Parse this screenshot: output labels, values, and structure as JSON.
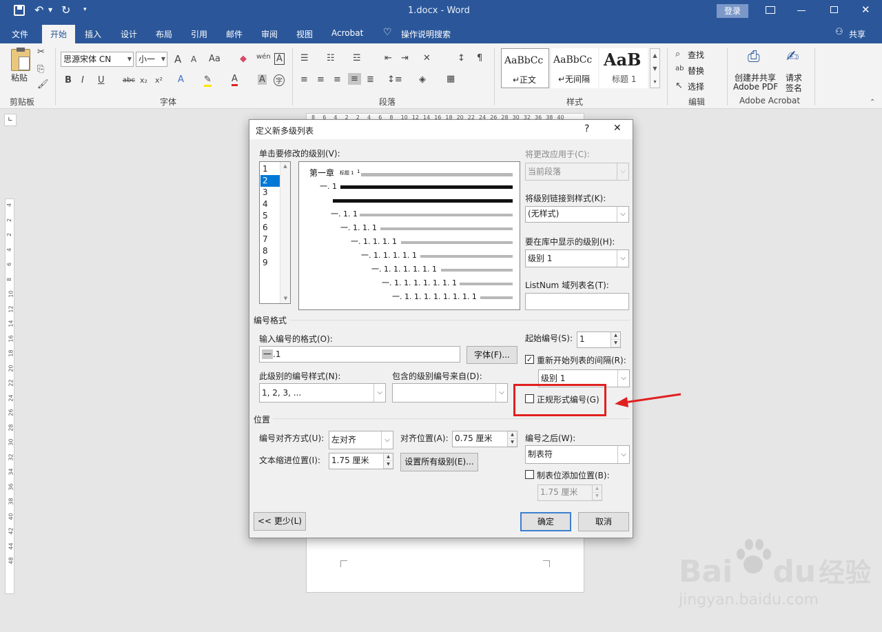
{
  "window": {
    "title": "1.docx - Word",
    "login": "登录"
  },
  "tabs": [
    "文件",
    "开始",
    "插入",
    "设计",
    "布局",
    "引用",
    "邮件",
    "审阅",
    "视图",
    "Acrobat",
    "操作说明搜索"
  ],
  "share": "共享",
  "ribbon": {
    "clipboard": {
      "label": "剪贴板",
      "paste": "粘贴"
    },
    "font": {
      "label": "字体",
      "name": "思源宋体 CN",
      "size": "小一",
      "tools": [
        "A",
        "A",
        "Aa",
        "wén",
        "A",
        "B",
        "I",
        "U",
        "abc",
        "x₂",
        "x²",
        "A",
        "A",
        "A",
        "A",
        "字"
      ]
    },
    "paragraph": {
      "label": "段落"
    },
    "styles": {
      "label": "样式",
      "items": [
        {
          "preview": "AaBbCc",
          "name": "↵正文"
        },
        {
          "preview": "AaBbCc",
          "name": "↵无间隔"
        },
        {
          "preview": "AaB",
          "name": "标题 1"
        }
      ]
    },
    "editing": {
      "label": "编辑",
      "find": "查找",
      "replace": "替换",
      "select": "选择"
    },
    "acrobat": {
      "label": "Adobe Acrobat",
      "create1": "创建并共享",
      "create2": "Adobe PDF",
      "sign1": "请求",
      "sign2": "签名"
    }
  },
  "ruler_h": [
    "8",
    "6",
    "4",
    "2",
    "2",
    "4",
    "6",
    "8",
    "10",
    "12",
    "14",
    "16",
    "18",
    "20",
    "22",
    "24",
    "26",
    "28",
    "30",
    "32",
    "36",
    "38",
    "40"
  ],
  "ruler_v": [
    "4",
    "2",
    "2",
    "4",
    "6",
    "8",
    "10",
    "12",
    "14",
    "16",
    "18",
    "20",
    "22",
    "24",
    "26",
    "28",
    "30",
    "32",
    "34",
    "36",
    "38",
    "40",
    "42",
    "44",
    "48"
  ],
  "dialog": {
    "title": "定义新多级列表",
    "help": "?",
    "close": "✕",
    "level_prompt": "单击要修改的级别(V):",
    "levels": [
      "1",
      "2",
      "3",
      "4",
      "5",
      "6",
      "7",
      "8",
      "9"
    ],
    "selected_level": "2",
    "preview": [
      "第一章",
      "标题 1",
      "一. 1",
      "一. 1. 1",
      "一. 1. 1. 1",
      "一. 1. 1. 1. 1",
      "一. 1. 1. 1. 1. 1",
      "一. 1. 1. 1. 1. 1. 1",
      "一. 1. 1. 1. 1. 1. 1. 1",
      "一. 1. 1. 1. 1. 1. 1. 1. 1"
    ],
    "apply_to_label": "将更改应用于(C):",
    "apply_to_value": "当前段落",
    "link_style_label": "将级别链接到样式(K):",
    "link_style_value": "(无样式)",
    "gallery_level_label": "要在库中显示的级别(H):",
    "gallery_level_value": "级别 1",
    "listnum_label": "ListNum 域列表名(T):",
    "listnum_value": "",
    "number_format_section": "编号格式",
    "enter_format_label": "输入编号的格式(O):",
    "format_prefix": "一",
    "format_value": ".1",
    "font_button": "字体(F)...",
    "start_at_label": "起始编号(S):",
    "start_at_value": "1",
    "restart_label": "重新开始列表的间隔(R):",
    "restart_value": "级别 1",
    "number_style_label": "此级别的编号样式(N):",
    "number_style_value": "1, 2, 3, ...",
    "include_level_label": "包含的级别编号来自(D):",
    "include_level_value": "",
    "legal_label": "正规形式编号(G)",
    "position_section": "位置",
    "alignment_label": "编号对齐方式(U):",
    "alignment_value": "左对齐",
    "align_at_label": "对齐位置(A):",
    "align_at_value": "0.75 厘米",
    "indent_label": "文本缩进位置(I):",
    "indent_value": "1.75 厘米",
    "set_all_button": "设置所有级别(E)...",
    "follow_label": "编号之后(W):",
    "follow_value": "制表符",
    "tab_stop_label": "制表位添加位置(B):",
    "tab_stop_value": "1.75 厘米",
    "less_button": "<< 更少(L)",
    "ok_button": "确定",
    "cancel_button": "取消"
  },
  "watermark": {
    "brand": "Bai",
    "brand2": "du",
    "cn": "经验",
    "url": "jingyan.baidu.com"
  },
  "colors": {
    "accent": "#2b579a",
    "highlight": "#e02020",
    "selection": "#0078d7"
  }
}
